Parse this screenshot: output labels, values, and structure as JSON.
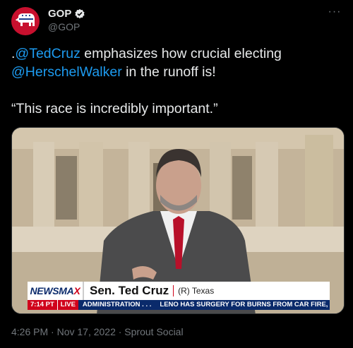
{
  "account": {
    "display_name": "GOP",
    "handle": "@GOP",
    "avatar_icon": "elephant-logo-icon",
    "verified_icon": "verified-badge-icon",
    "brand_color": "#c8102e"
  },
  "tweet": {
    "line1_prefix": ".",
    "mention1": "@TedCruz",
    "line1_suffix": " emphasizes how crucial electing",
    "mention2": "@HerschelWalker",
    "line2_suffix": " in the runoff is!",
    "quote": "“This race is incredibly important.”"
  },
  "media": {
    "network_logo_prefix": "NEWSMA",
    "network_logo_x": "X",
    "name_plate": "Sen. Ted Cruz",
    "party": "(R) Texas",
    "ticker_time": "7:14 PT",
    "ticker_live": "LIVE",
    "ticker_item1": "ADMINISTRATION . . .",
    "ticker_item2": "LENO HAS SURGERY FOR BURNS FROM CAR FIRE, IN GOOD C"
  },
  "footer": {
    "timestamp": "4:26 PM · Nov 17, 2022 · Sprout Social"
  },
  "colors": {
    "background": "#000000",
    "text": "#e7e9ea",
    "link": "#1d9bf0",
    "muted": "#71767b"
  }
}
